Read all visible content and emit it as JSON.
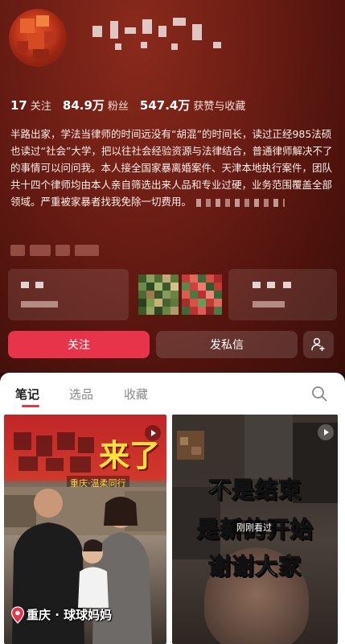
{
  "profile": {
    "stats": [
      {
        "count": "17",
        "label": "关注"
      },
      {
        "count": "84.9万",
        "label": "粉丝"
      },
      {
        "count": "547.4万",
        "label": "获赞与收藏"
      }
    ],
    "bio": "半路出家，学法当律师的时间远没有“胡混”的时间长，读过正经985法硕也读过“社会”大学，把以往社会经验资源与法律结合，普通律师解决不了的事情可以问问我。本人接全国家暴离婚案件、天津本地执行案件，团队共十四个律师均由本人亲自筛选出来人品和专业过硬，业务范围覆盖全部领域。严重被家暴者找我免除一切费用。"
  },
  "actions": {
    "follow_label": "关注",
    "message_label": "发私信"
  },
  "tabs": [
    {
      "label": "笔记",
      "active": true
    },
    {
      "label": "选品",
      "active": false
    },
    {
      "label": "收藏",
      "active": false
    }
  ],
  "posts": [
    {
      "title_text": "来了",
      "subtitle": "重庆·温柔同行",
      "location": "重庆 · 球球妈妈"
    },
    {
      "lines": [
        "不是结束",
        "是新的开始",
        "谢谢大家"
      ],
      "recent_label": "刚刚看过"
    }
  ],
  "colors": {
    "accent": "#e8344a",
    "header_bg": "#6b1d14",
    "title_yellow": "#ffe23a"
  }
}
